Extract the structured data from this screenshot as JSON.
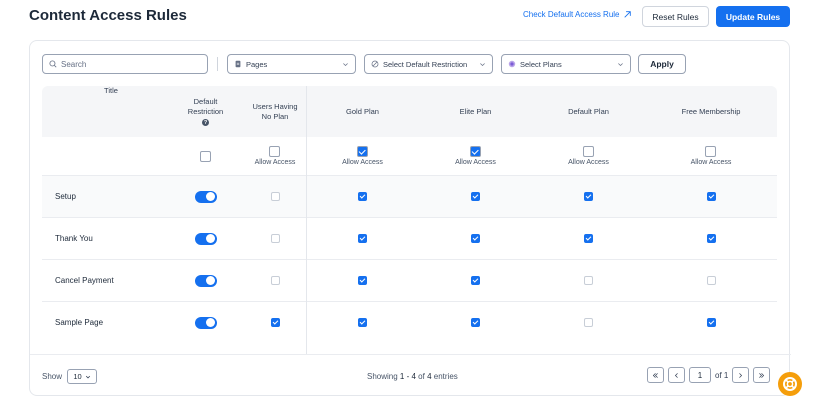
{
  "header": {
    "title": "Content Access Rules",
    "check_link": "Check Default Access Rule",
    "reset_label": "Reset Rules",
    "update_label": "Update Rules"
  },
  "filters": {
    "search_placeholder": "Search",
    "pages_label": "Pages",
    "restriction_label": "Select Default Restriction",
    "plans_label": "Select Plans",
    "apply_label": "Apply"
  },
  "table": {
    "headers": {
      "title": "Title",
      "default_line1": "Default",
      "default_line2": "Restriction",
      "noplan_line1": "Users Having",
      "noplan_line2": "No Plan",
      "plans": [
        "Gold Plan",
        "Elite Plan",
        "Default Plan",
        "Free Membership"
      ]
    },
    "master": {
      "default_checked": false,
      "noplan": {
        "label": "Allow Access",
        "checked": false
      },
      "plans": [
        {
          "label": "Allow Access",
          "checked": true
        },
        {
          "label": "Allow Access",
          "checked": true
        },
        {
          "label": "Allow Access",
          "checked": false
        },
        {
          "label": "Allow Access",
          "checked": false
        }
      ]
    },
    "rows": [
      {
        "title": "Setup",
        "restriction_on": true,
        "noplan": false,
        "plans": [
          true,
          true,
          true,
          true
        ]
      },
      {
        "title": "Thank You",
        "restriction_on": true,
        "noplan": false,
        "plans": [
          true,
          true,
          true,
          true
        ]
      },
      {
        "title": "Cancel Payment",
        "restriction_on": true,
        "noplan": false,
        "plans": [
          true,
          true,
          false,
          false
        ]
      },
      {
        "title": "Sample Page",
        "restriction_on": true,
        "noplan": true,
        "plans": [
          true,
          true,
          false,
          true
        ]
      }
    ]
  },
  "footer": {
    "show_label": "Show",
    "page_size": "10",
    "entries_prefix": "Showing",
    "entries_range": "1 - 4",
    "entries_of": "of",
    "entries_total": "4",
    "entries_suffix": "entries",
    "current_page": "1",
    "of_total": "of 1"
  },
  "colors": {
    "accent": "#1570ef",
    "fab": "#f59e0b"
  }
}
